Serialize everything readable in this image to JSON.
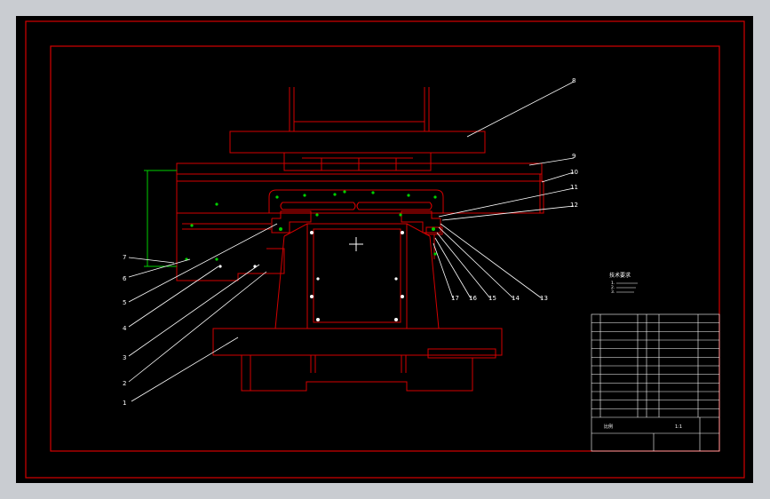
{
  "drawing": {
    "background": "#000000",
    "frame_color": "#d40000",
    "detail_color": "#00d000",
    "leader_color": "#ffffff"
  },
  "part_numbers": [
    "1",
    "2",
    "3",
    "4",
    "5",
    "6",
    "7",
    "8",
    "9",
    "10",
    "11",
    "12",
    "13",
    "14",
    "15",
    "16",
    "17"
  ],
  "notes": {
    "title": "技术要求",
    "lines": [
      "1.",
      "2.",
      "3."
    ]
  },
  "title_block": {
    "row_count": 12,
    "footer_label": "比例",
    "footer_value": "1:1"
  }
}
